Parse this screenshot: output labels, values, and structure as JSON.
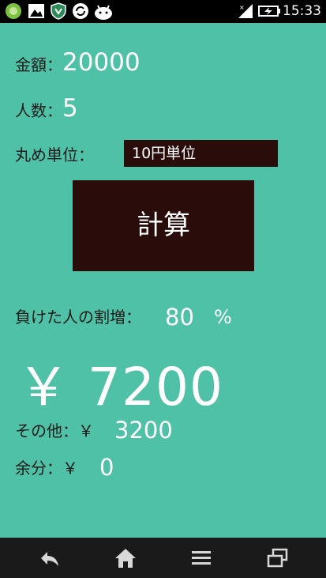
{
  "status_bar": {
    "time": "15:33",
    "icons_left": [
      "app-green-icon",
      "gallery-icon",
      "shield-icon",
      "sync-icon",
      "android-icon"
    ],
    "icons_right": [
      "signal-icon",
      "battery-charging-icon"
    ]
  },
  "form": {
    "amount_label": "金額：",
    "amount_value": "20000",
    "people_label": "人数：",
    "people_value": "5",
    "rounding_label": "丸め単位：",
    "rounding_value": "10円単位",
    "calc_button": "計算",
    "loser_surcharge_label": "負けた人の割増：",
    "loser_surcharge_value": "80",
    "percent_sign": "%"
  },
  "result": {
    "main_amount": "￥ 7200",
    "others_label": "その他：￥",
    "others_value": "3200",
    "remainder_label": "余分：￥",
    "remainder_value": "0"
  },
  "colors": {
    "background": "#4FC1A6",
    "button": "#2A0D0A",
    "text_dark": "#1c1c1c",
    "text_light": "#ffffff"
  },
  "navigation": [
    "back-icon",
    "home-icon",
    "menu-icon",
    "recent-apps-icon"
  ]
}
